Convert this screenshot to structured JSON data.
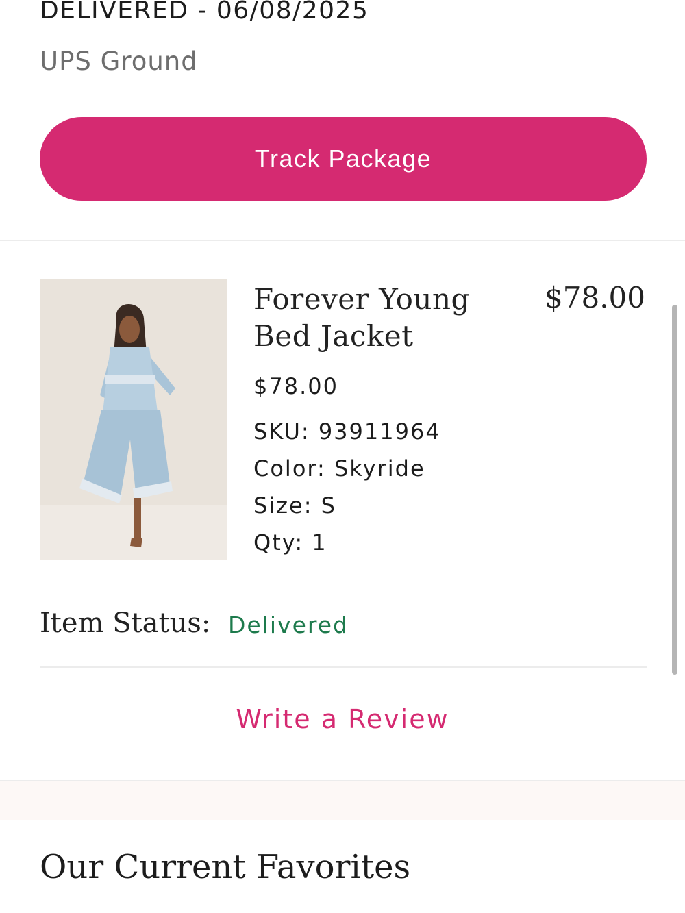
{
  "shipment": {
    "status": "DELIVERED - 06/08/2025",
    "carrier": "UPS Ground",
    "track_label": "Track Package"
  },
  "item": {
    "name": "Forever Young Bed Jacket",
    "line_total": "$78.00",
    "price": "$78.00",
    "sku": "SKU: 93911964",
    "color": "Color: Skyride",
    "size": "Size: S",
    "qty": "Qty: 1",
    "status_label": "Item Status:",
    "status_value": "Delivered",
    "review_label": "Write a Review"
  },
  "favorites": {
    "title": "Our Current Favorites"
  },
  "colors": {
    "accent": "#d52a71",
    "status_green": "#1d7a4c"
  }
}
